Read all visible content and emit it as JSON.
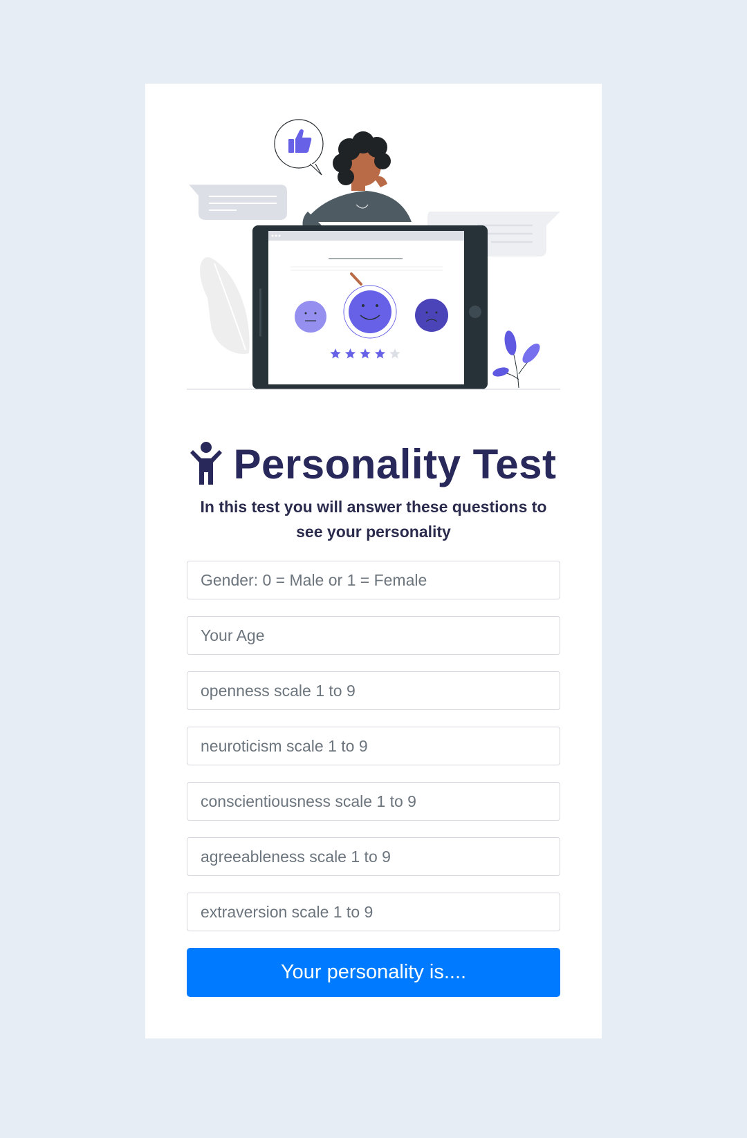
{
  "header": {
    "title": "Personality Test",
    "subtitle": "In this test you will answer these questions to see your personality"
  },
  "illustration": {
    "icons": [
      "thumbs-up-icon",
      "neutral-face-icon",
      "happy-face-icon",
      "sad-face-icon",
      "star-icon"
    ],
    "rating_stars": 4,
    "rating_max": 5
  },
  "form": {
    "fields": [
      {
        "placeholder": "Gender: 0 = Male or 1 = Female",
        "value": ""
      },
      {
        "placeholder": "Your Age",
        "value": ""
      },
      {
        "placeholder": "openness scale 1 to 9",
        "value": ""
      },
      {
        "placeholder": "neuroticism scale 1 to 9",
        "value": ""
      },
      {
        "placeholder": "conscientiousness scale 1 to 9",
        "value": ""
      },
      {
        "placeholder": "agreeableness scale 1 to 9",
        "value": ""
      },
      {
        "placeholder": "extraversion scale 1 to 9",
        "value": ""
      }
    ],
    "submit_label": "Your personality is...."
  },
  "colors": {
    "page_background": "#e6edf5",
    "card_background": "#ffffff",
    "title": "#28285a",
    "accent_purple": "#6761e8",
    "button": "#007bff",
    "button_text": "#ffffff"
  }
}
